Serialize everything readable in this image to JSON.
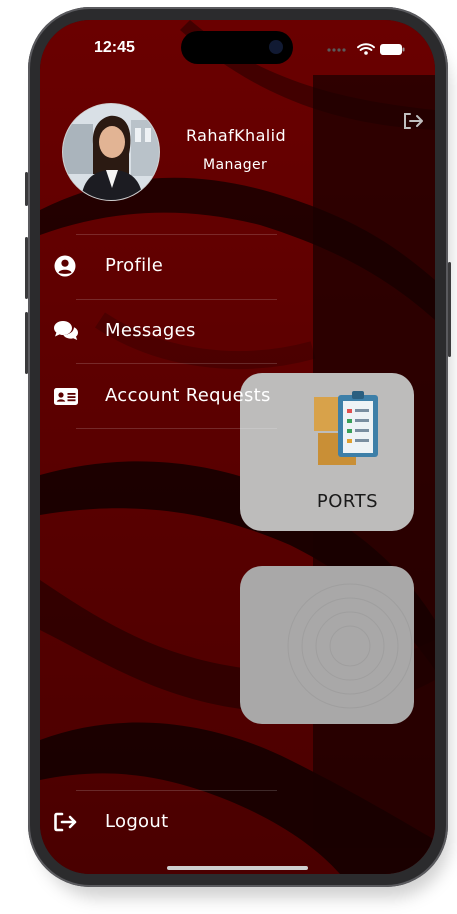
{
  "status_bar": {
    "time": "12:45"
  },
  "drawer": {
    "user": {
      "name": "RahafKhalid",
      "role": "Manager"
    },
    "menu": [
      {
        "label": "Profile",
        "icon": "user-circle-icon"
      },
      {
        "label": "Messages",
        "icon": "chat-bubbles-icon"
      },
      {
        "label": "Account Requests",
        "icon": "id-card-icon"
      }
    ],
    "logout": {
      "label": "Logout",
      "icon": "sign-out-icon"
    }
  },
  "background_page": {
    "cards": [
      {
        "label": "PORTS"
      },
      {
        "label": ""
      }
    ]
  },
  "colors": {
    "drawer_bg": "#5a0000",
    "text": "#ffffff",
    "card_bg": "#bdbcbb"
  }
}
